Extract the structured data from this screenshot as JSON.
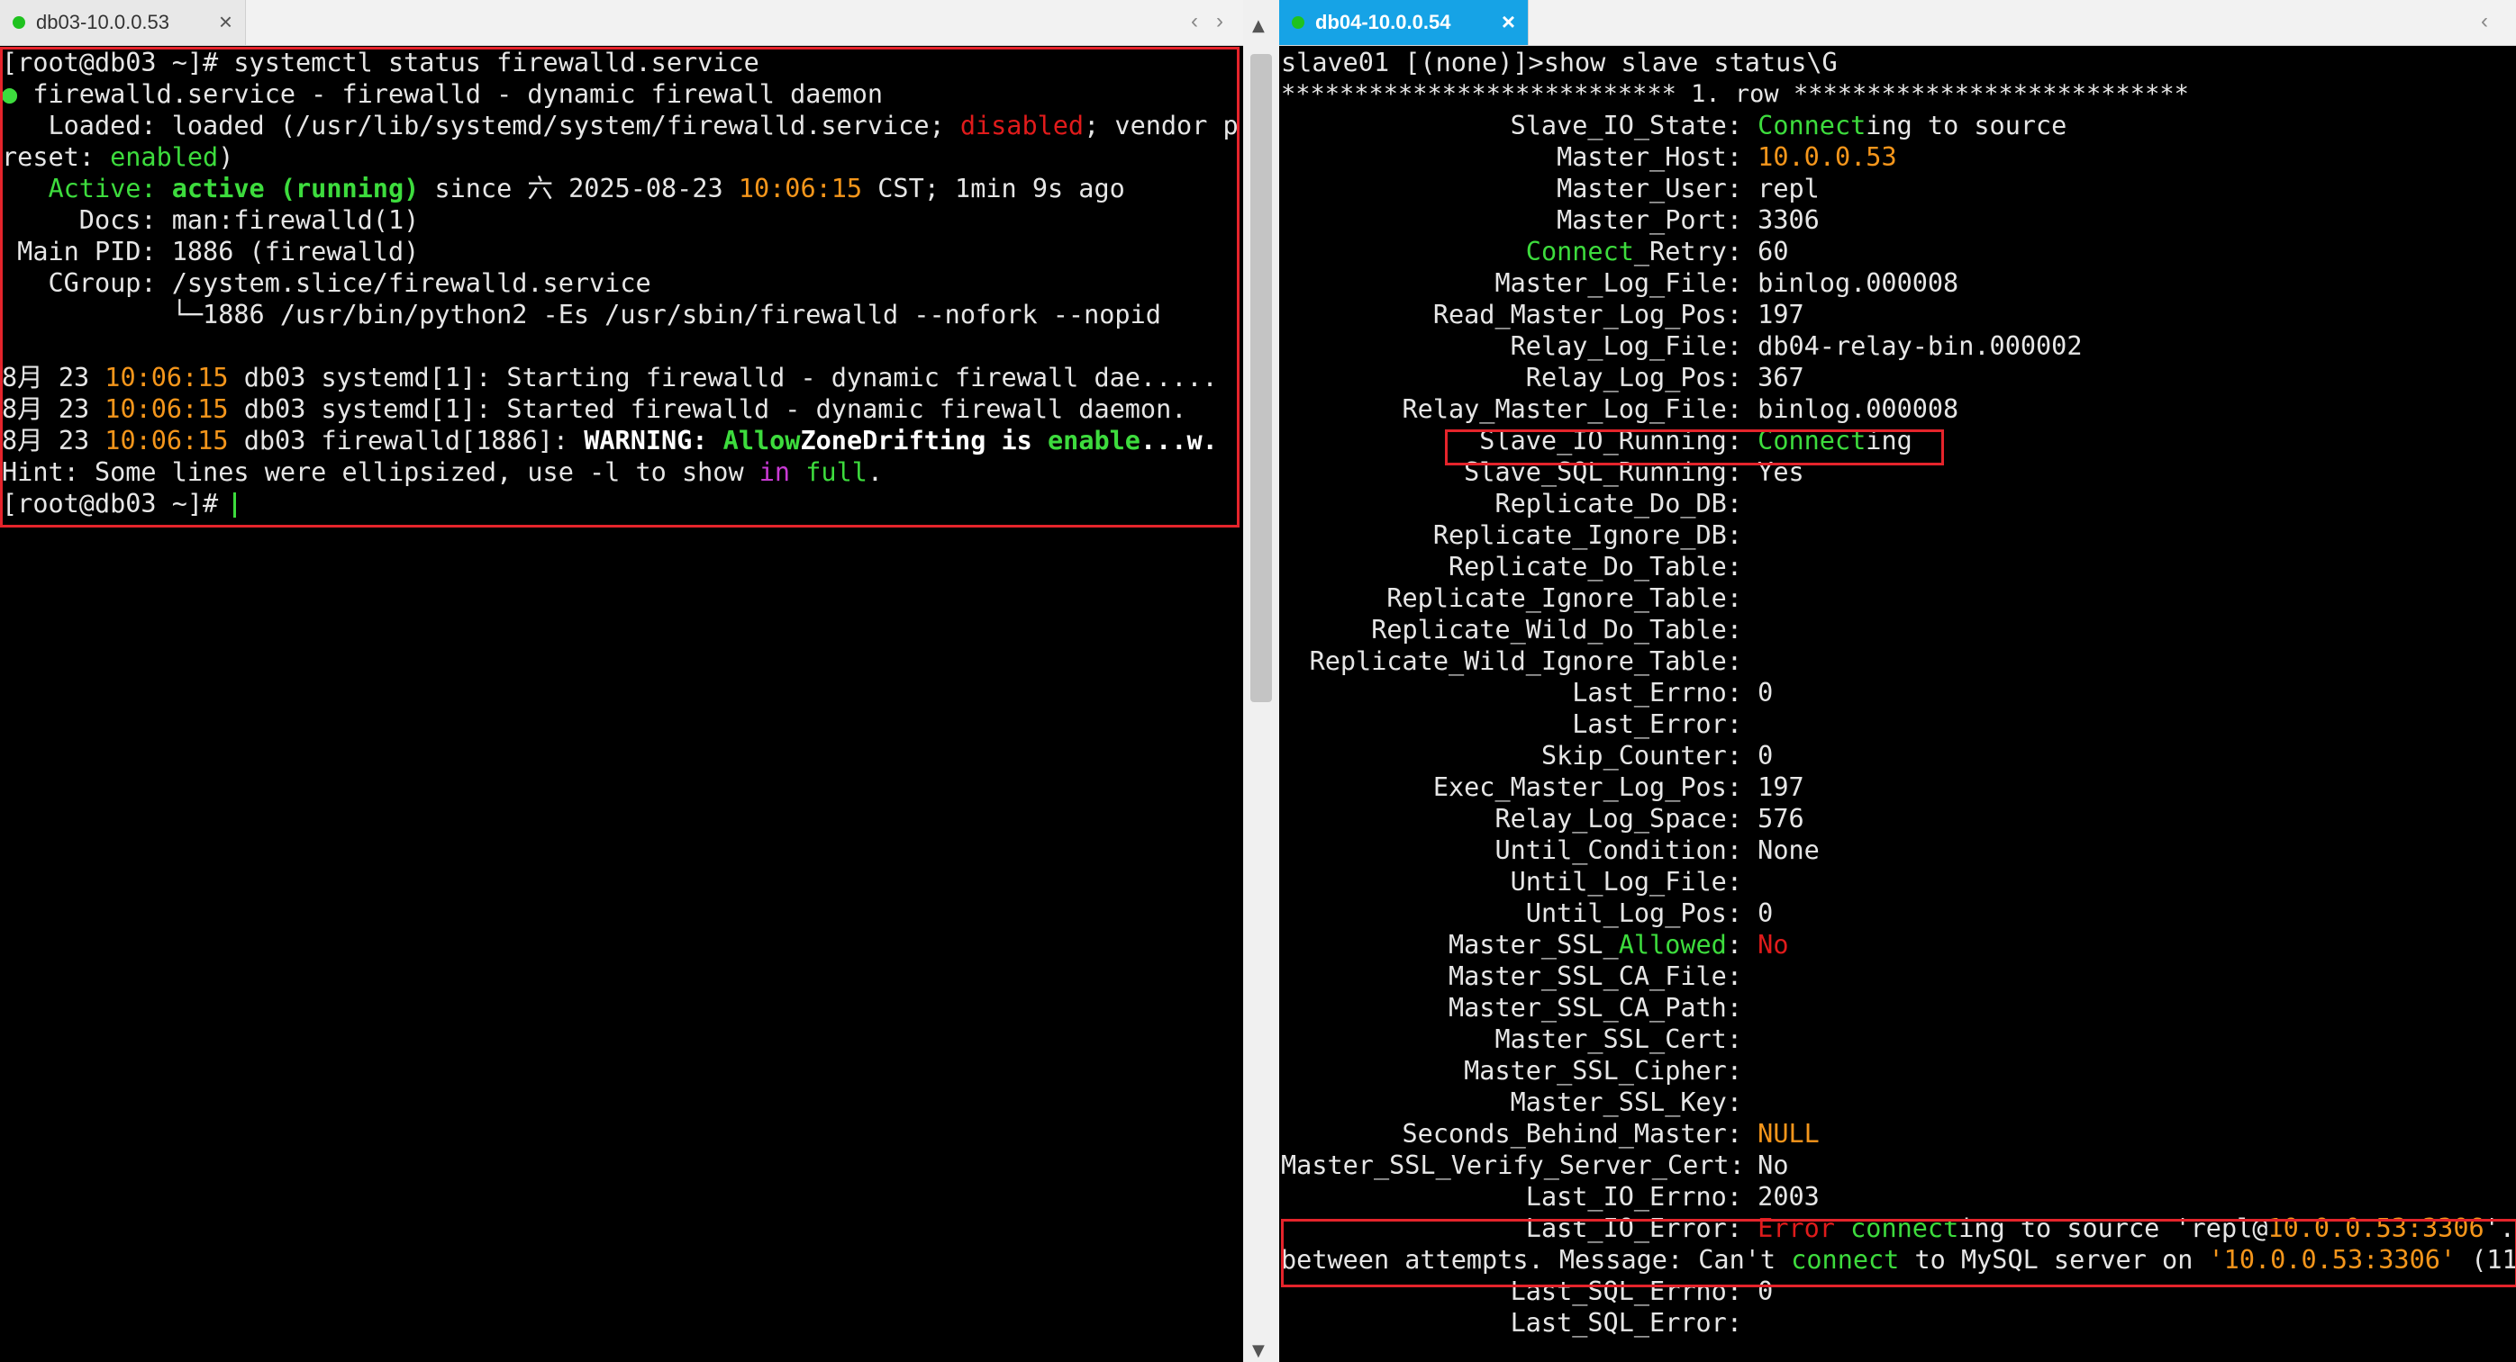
{
  "left": {
    "tab_label": "db03-10.0.0.53",
    "lines": {
      "l1": "[root@db03 ~]# systemctl status firewalld.service",
      "l2a": "●",
      "l2b": " firewalld.service - firewalld - dynamic firewall daemon",
      "l3a": "   Loaded: loaded (/usr/lib/systemd/system/firewalld.service; ",
      "l3b": "disabled",
      "l3c": "; vendor p",
      "l4a": "reset: ",
      "l4b": "enabled",
      "l4c": ")",
      "l5a": "   Active: ",
      "l5b": "active (running)",
      "l5c": " since 六 2025-08-23 ",
      "l5d": "10:06:15",
      "l5e": " CST; 1min 9s ago",
      "l6": "     Docs: man:firewalld(1)",
      "l7": " Main PID: 1886 (firewalld)",
      "l8": "   CGroup: /system.slice/firewalld.service",
      "l9": "           └─1886 /usr/bin/python2 -Es /usr/sbin/firewalld --nofork --nopid",
      "l10a": "8月 23 ",
      "l10b": "10:06:15",
      "l10c": " db03 systemd[1]: Starting firewalld - dynamic firewall dae.....",
      "l11a": "8月 23 ",
      "l11b": "10:06:15",
      "l11c": " db03 systemd[1]: Started firewalld - dynamic firewall daemon.",
      "l12a": "8月 23 ",
      "l12b": "10:06:15",
      "l12c": " db03 firewalld[1886]: ",
      "l12d": "WARNING: ",
      "l12e": "Allow",
      "l12f": "ZoneDrifting is ",
      "l12g": "enable",
      "l12h": "...w.",
      "l13a": "Hint: Some lines were ellipsized, use -l to show ",
      "l13b": "in",
      "l13c": " ",
      "l13d": "full",
      "l13e": ".",
      "l14": "[root@db03 ~]# "
    }
  },
  "right": {
    "tab_label": "db04-10.0.0.54",
    "prompt": "slave01 [(none)]>show slave status\\G",
    "row_header": "*************************** 1. row ***************************",
    "fields": [
      {
        "label": "Slave_IO_State:",
        "value": " Connecting to source"
      },
      {
        "label": "Master_Host:",
        "value": " 10.0.0.53"
      },
      {
        "label": "Master_User:",
        "value": " repl"
      },
      {
        "label": "Master_Port:",
        "value": " 3306"
      },
      {
        "label": "Connect_Retry:",
        "value": " 60"
      },
      {
        "label": "Master_Log_File:",
        "value": " binlog.000008"
      },
      {
        "label": "Read_Master_Log_Pos:",
        "value": " 197"
      },
      {
        "label": "Relay_Log_File:",
        "value": " db04-relay-bin.000002"
      },
      {
        "label": "Relay_Log_Pos:",
        "value": " 367"
      },
      {
        "label": "Relay_Master_Log_File:",
        "value": " binlog.000008"
      },
      {
        "label": "Slave_IO_Running:",
        "value": " Connecting"
      },
      {
        "label": "Slave_SQL_Running:",
        "value": " Yes"
      },
      {
        "label": "Replicate_Do_DB:",
        "value": ""
      },
      {
        "label": "Replicate_Ignore_DB:",
        "value": ""
      },
      {
        "label": "Replicate_Do_Table:",
        "value": ""
      },
      {
        "label": "Replicate_Ignore_Table:",
        "value": ""
      },
      {
        "label": "Replicate_Wild_Do_Table:",
        "value": ""
      },
      {
        "label": "Replicate_Wild_Ignore_Table:",
        "value": ""
      },
      {
        "label": "Last_Errno:",
        "value": " 0"
      },
      {
        "label": "Last_Error:",
        "value": ""
      },
      {
        "label": "Skip_Counter:",
        "value": " 0"
      },
      {
        "label": "Exec_Master_Log_Pos:",
        "value": " 197"
      },
      {
        "label": "Relay_Log_Space:",
        "value": " 576"
      },
      {
        "label": "Until_Condition:",
        "value": " None"
      },
      {
        "label": "Until_Log_File:",
        "value": ""
      },
      {
        "label": "Until_Log_Pos:",
        "value": " 0"
      },
      {
        "label": "Master_SSL_Allowed:",
        "value": " No"
      },
      {
        "label": "Master_SSL_CA_File:",
        "value": ""
      },
      {
        "label": "Master_SSL_CA_Path:",
        "value": ""
      },
      {
        "label": "Master_SSL_Cert:",
        "value": ""
      },
      {
        "label": "Master_SSL_Cipher:",
        "value": ""
      },
      {
        "label": "Master_SSL_Key:",
        "value": ""
      },
      {
        "label": "Seconds_Behind_Master:",
        "value": " NULL"
      },
      {
        "label": "Master_SSL_Verify_Server_Cert:",
        "value": " No"
      },
      {
        "label": "Last_IO_Errno:",
        "value": " 2003"
      },
      {
        "label": "Last_IO_Error:",
        "value": " Error connecting to source 'repl@10.0.0.53:3306'."
      },
      {
        "label": "",
        "value": "between attempts. Message: Can't connect to MySQL server on '10.0.0.53:3306' (11"
      },
      {
        "label": "Last_SQL_Errno:",
        "value": " 0"
      },
      {
        "label": "Last_SQL_Error:",
        "value": ""
      }
    ]
  },
  "colors": {
    "green": "#3ddc3d",
    "red": "#e01b1b",
    "orange": "#f5961b",
    "magenta": "#c93ad4",
    "highlight": "#e5242b",
    "active_tab": "#16a3e6"
  },
  "icons": {
    "tab_dot": "status-dot-icon",
    "close": "close-icon",
    "prev": "chevron-left-icon",
    "next": "chevron-right-icon",
    "menu": "chevron-down-icon"
  },
  "glyphs": {
    "close": "×",
    "prev": "‹",
    "next": "›",
    "menu": "⌄",
    "scroll_up": "▲",
    "scroll_down": "▼"
  }
}
